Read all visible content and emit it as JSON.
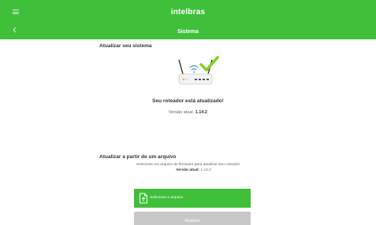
{
  "header": {
    "brand": "intelbras",
    "title": "Sistema"
  },
  "system_update": {
    "heading": "Atualizar seu sistema",
    "status": "Seu roteador está atualizado!",
    "version_label": "Versão atual:",
    "version_value": "1.14.2"
  },
  "file_update": {
    "heading": "Atualizar a partir de um arquivo",
    "description": "Selecione um arquivo de firmware para atualizar seu roteador",
    "version_label": "Versão atual:",
    "version_value": "1.14.2",
    "select_button": "Selecione o arquivo",
    "update_button": "Atualizar"
  },
  "colors": {
    "brand_green": "#3fbf3a",
    "check_green": "#7ed321",
    "disabled_gray": "#c8c8c8"
  },
  "icons": [
    "menu-icon",
    "back-icon",
    "router-icon",
    "checkmark-icon",
    "upload-file-icon"
  ]
}
